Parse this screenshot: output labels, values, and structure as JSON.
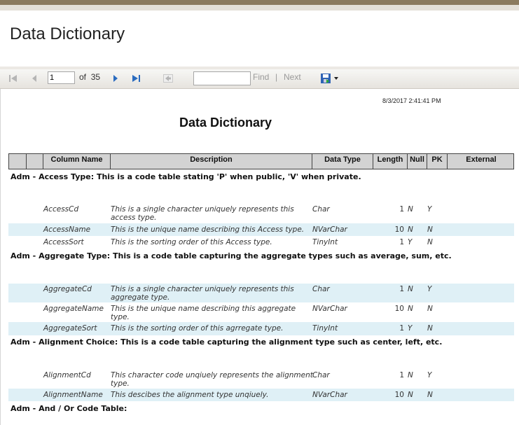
{
  "page": {
    "title": "Data Dictionary"
  },
  "toolbar": {
    "current_page": "1",
    "of_label": "of",
    "total_pages": "35",
    "find_placeholder": "",
    "find_label": "Find",
    "separator": "|",
    "next_label": "Next"
  },
  "report": {
    "timestamp": "8/3/2017 2:41:41 PM",
    "title": "Data Dictionary",
    "columns": [
      "Column Name",
      "Description",
      "Data Type",
      "Length",
      "Null",
      "PK",
      "External"
    ],
    "groups": [
      {
        "header": "Adm - Access Type: This is a code table stating 'P' when public, 'V' when private.",
        "rows": [
          {
            "name": "AccessCd",
            "desc": "This is a single character uniquely represents this access type.",
            "type": "Char",
            "length": "1",
            "null": "N",
            "pk": "Y"
          },
          {
            "name": "AccessName",
            "desc": "This is the unique name describing this Access type.",
            "type": "NVarChar",
            "length": "10",
            "null": "N",
            "pk": "N"
          },
          {
            "name": "AccessSort",
            "desc": "This is the sorting order of this Access type.",
            "type": "TinyInt",
            "length": "1",
            "null": "Y",
            "pk": "N"
          }
        ]
      },
      {
        "header": "Adm - Aggregate Type: This is a code table capturing the aggregate types such as average, sum, etc.",
        "rows": [
          {
            "name": "AggregateCd",
            "desc": "This is a single character uniquely represents this aggregate type.",
            "type": "Char",
            "length": "1",
            "null": "N",
            "pk": "Y"
          },
          {
            "name": "AggregateName",
            "desc": "This is the unique name describing this aggregate type.",
            "type": "NVarChar",
            "length": "10",
            "null": "N",
            "pk": "N"
          },
          {
            "name": "AggregateSort",
            "desc": "This is the sorting order of this agrregate type.",
            "type": "TinyInt",
            "length": "1",
            "null": "Y",
            "pk": "N"
          }
        ]
      },
      {
        "header": "Adm - Alignment Choice: This is a code table capturing the alignment type such as center, left, etc.",
        "rows": [
          {
            "name": "AlignmentCd",
            "desc": "This character code unqiuely represents the alignment type.",
            "type": "Char",
            "length": "1",
            "null": "N",
            "pk": "Y"
          },
          {
            "name": "AlignmentName",
            "desc": "This descibes the alignment type unqiuely.",
            "type": "NVarChar",
            "length": "10",
            "null": "N",
            "pk": "N"
          }
        ]
      },
      {
        "header": "Adm - And / Or Code Table:",
        "rows": []
      }
    ]
  },
  "colors": {
    "row_alt": "#dff0f6",
    "header_bg": "#d3d3d3",
    "top_bar": "#8b7b5f"
  },
  "icons": [
    "first-page-icon",
    "previous-page-icon",
    "next-page-icon",
    "last-page-icon",
    "back-icon",
    "export-save-icon",
    "dropdown-arrow-icon"
  ]
}
